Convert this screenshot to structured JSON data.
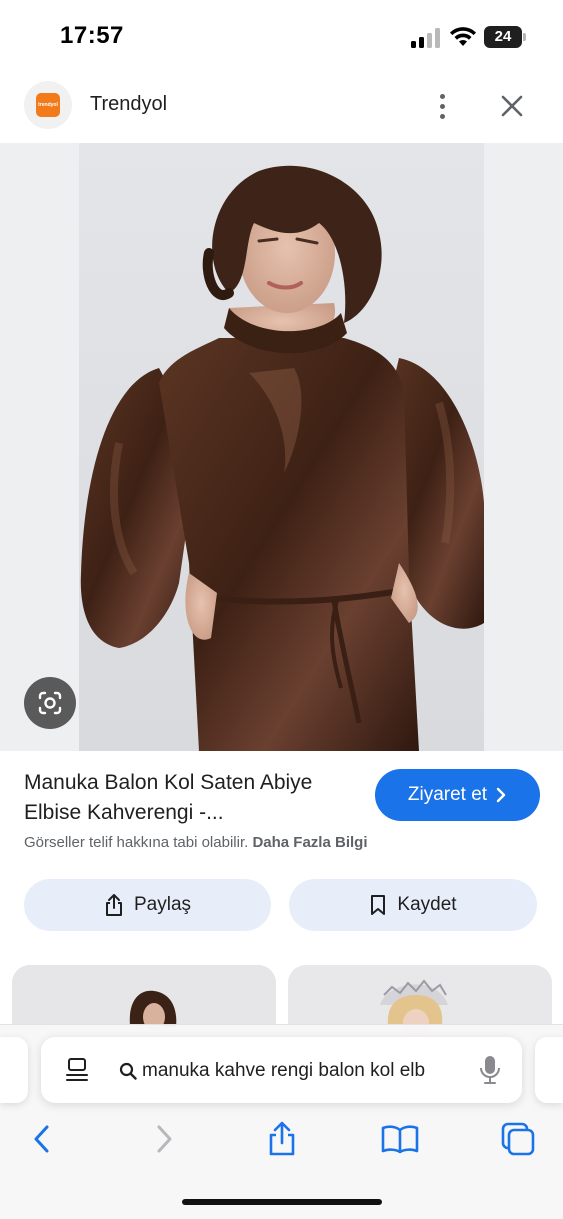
{
  "status_bar": {
    "time": "17:57",
    "battery": "24"
  },
  "header": {
    "site_logo_text": "trendyol",
    "site_name": "Trendyol"
  },
  "result": {
    "title": "Manuka Balon Kol Saten Abiye Elbise Kahverengi -...",
    "visit_label": "Ziyaret et",
    "copyright_text": "Görseller telif hakkına tabi olabilir.",
    "more_info_label": "Daha Fazla Bilgi",
    "share_label": "Paylaş",
    "save_label": "Kaydet"
  },
  "address_bar": {
    "query": "manuka kahve rengi balon kol elb"
  },
  "icons": {
    "lens": "lens-icon",
    "share": "share-icon",
    "bookmark": "bookmark-icon",
    "back": "back-arrow-icon",
    "forward": "forward-arrow-icon",
    "bookmarks": "bookmarks-icon",
    "tabs": "tabs-icon",
    "mic": "mic-icon",
    "reader": "reader-icon"
  },
  "colors": {
    "accent": "#1a73e8",
    "button_bg": "#e8eef9",
    "dress": "#4a2a1c"
  }
}
